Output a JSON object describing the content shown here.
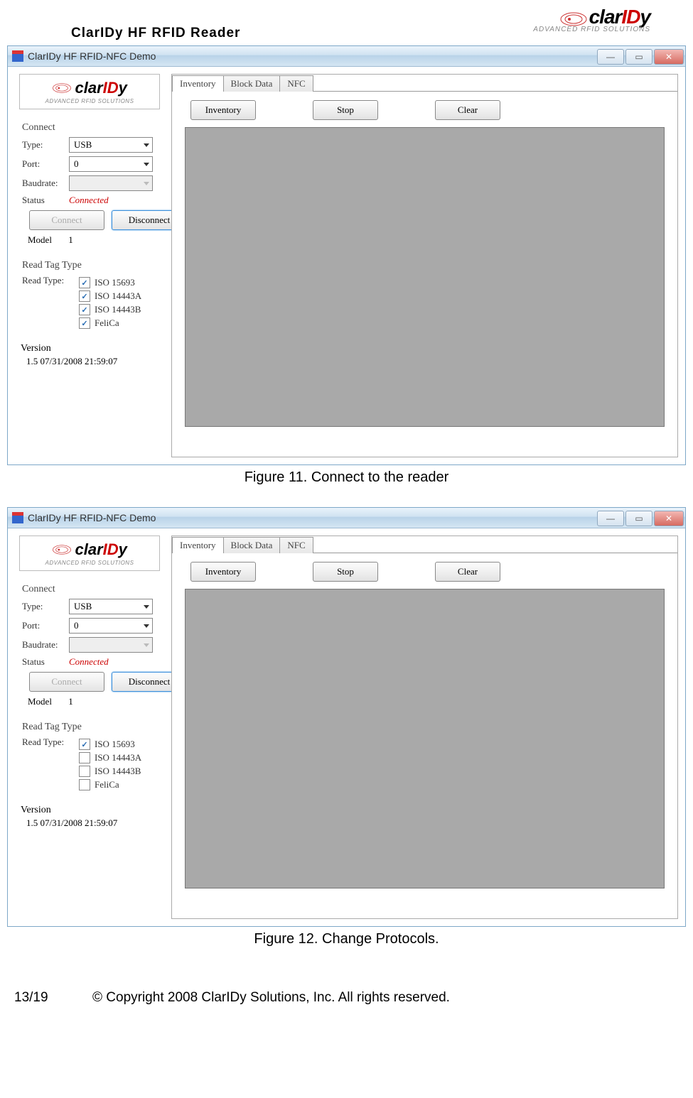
{
  "doc": {
    "title": "ClarIDy  HF  RFID  Reader",
    "brand_name_pre": "clar",
    "brand_name_mid": "ID",
    "brand_name_post": "y",
    "brand_tag": "ADVANCED RFID SOLUTIONS",
    "page_num": "13/19",
    "copyright": "© Copyright 2008 ClarIDy Solutions, Inc. All rights reserved."
  },
  "captions": {
    "fig1": "Figure 11. Connect to the reader",
    "fig2": "Figure 12. Change Protocols."
  },
  "app": {
    "title": "ClarIDy HF RFID-NFC Demo",
    "sidebar": {
      "connect_label": "Connect",
      "type_label": "Type:",
      "type_value": "USB",
      "port_label": "Port:",
      "port_value": "0",
      "baud_label": "Baudrate:",
      "baud_value": "",
      "status_label": "Status",
      "status_value": "Connected",
      "connect_btn": "Connect",
      "disconnect_btn": "Disconnect",
      "model_label": "Model",
      "model_value": "1",
      "readtag_label": "Read Tag Type",
      "readtype_label": "Read Type:",
      "iso15693": "ISO 15693",
      "iso14443a": "ISO 14443A",
      "iso14443b": "ISO 14443B",
      "felica": "FeliCa",
      "version_label": "Version",
      "version_value": "1.5 07/31/2008 21:59:07"
    },
    "tabs": {
      "inventory": "Inventory",
      "blockdata": "Block Data",
      "nfc": "NFC"
    },
    "actions": {
      "inventory": "Inventory",
      "stop": "Stop",
      "clear": "Clear"
    }
  },
  "fig1_checks": {
    "iso15693": true,
    "iso14443a": true,
    "iso14443b": true,
    "felica": true
  },
  "fig2_checks": {
    "iso15693": true,
    "iso14443a": false,
    "iso14443b": false,
    "felica": false
  }
}
